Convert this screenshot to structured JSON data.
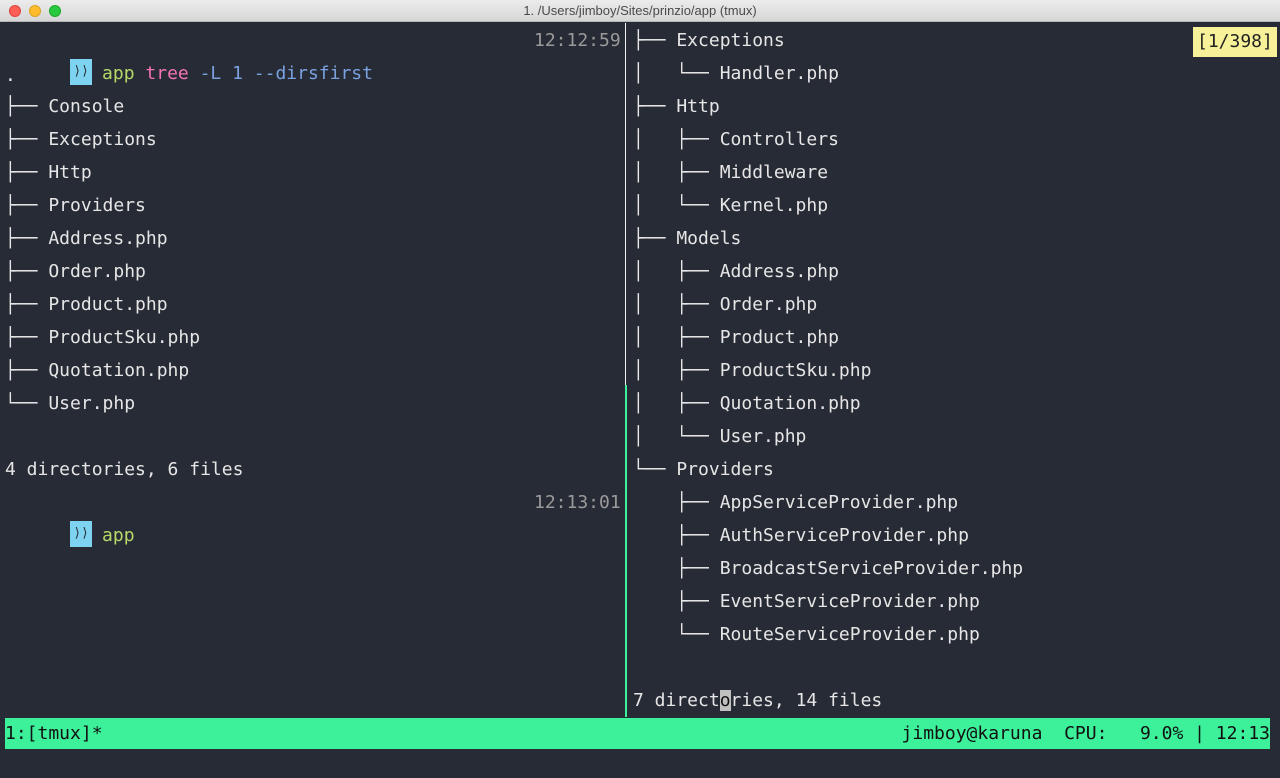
{
  "window": {
    "title": "1.  /Users/jimboy/Sites/prinzio/app (tmux)"
  },
  "left_pane": {
    "prompt1": {
      "dir": "app",
      "cmd": "tree",
      "args": "-L 1 --dirsfirst",
      "time": "12:12:59"
    },
    "dot": ".",
    "tree_lines": [
      "├── Console",
      "├── Exceptions",
      "├── Http",
      "├── Providers",
      "├── Address.php",
      "├── Order.php",
      "├── Product.php",
      "├── ProductSku.php",
      "├── Quotation.php",
      "└── User.php"
    ],
    "summary": "4 directories, 6 files",
    "prompt2": {
      "dir": "app",
      "time": "12:13:01"
    }
  },
  "right_pane": {
    "badge": "[1/398]",
    "tree_lines": [
      "├── Exceptions",
      "│   └── Handler.php",
      "├── Http",
      "│   ├── Controllers",
      "│   ├── Middleware",
      "│   └── Kernel.php",
      "├── Models",
      "│   ├── Address.php",
      "│   ├── Order.php",
      "│   ├── Product.php",
      "│   ├── ProductSku.php",
      "│   ├── Quotation.php",
      "│   └── User.php",
      "└── Providers",
      "    ├── AppServiceProvider.php",
      "    ├── AuthServiceProvider.php",
      "    ├── BroadcastServiceProvider.php",
      "    ├── EventServiceProvider.php",
      "    └── RouteServiceProvider.php"
    ],
    "summary_before": "7 direct",
    "summary_cursor": "o",
    "summary_after": "ries, 14 files"
  },
  "statusbar": {
    "left": "1:[tmux]*",
    "right": "jimboy@karuna  CPU:   9.0% | 12:13"
  },
  "colors": {
    "status_bg": "#3df09a",
    "prompt_box": "#7dd3f0",
    "badge_bg": "#f7f29a",
    "terminal_bg": "#272b35"
  }
}
